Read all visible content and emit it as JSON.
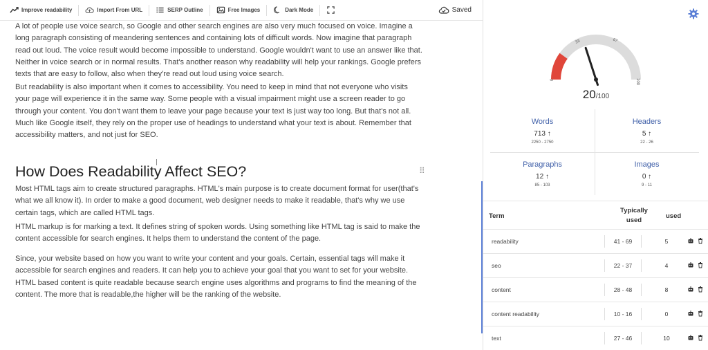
{
  "toolbar": {
    "improve_label": "Improve readability",
    "import_label": "Import From URL",
    "serp_label": "SERP Outline",
    "images_label": "Free Images",
    "dark_label": "Dark Mode",
    "saved_label": "Saved"
  },
  "editor": {
    "para1": "A lot of people use voice search, so Google and other search engines are also very much focused on voice. Imagine a long paragraph consisting of meandering sentences and containing lots of difficult words. Now imagine that paragraph read out loud. The voice result would become impossible to understand. Google wouldn't want to use an answer like that. Neither in voice search or in normal results. That's another reason why readability will help your rankings. Google prefers texts that are easy to follow, also when they're read out loud using voice search.",
    "para2": "But readability is also important when it comes to accessibility. You need to keep in mind that not everyone who visits your page will experience it in the same way. Some people with a visual impairment might use a screen reader to go through your content. You don't want them to leave your page because your text is just way too long. But that's not all. Much like Google itself, they rely on the proper use of headings to understand what your text is about. Remember that accessibility matters, and not just for SEO.",
    "heading": "How Does Readability Affect SEO?",
    "para3": "Most HTML tags aim to create structured paragraphs. HTML's main purpose is to create document format for user(that's what we all know it). In order to make a good document, web designer needs to make it readable, that's why we use certain tags, which are called HTML tags.",
    "para4": "HTML markup is for marking a text. It defines string of spoken words. Using something like HTML tag is said to make the content accessible for search engines. It helps them to understand the content of the page.",
    "para5": "Since, your website based on how you want to write your content and your goals. Certain, essential tags will make it accessible for search engines and readers. It can help you to achieve your goal that you want to set for your website.",
    "para6": "HTML based content is quite readable because search engine uses algorithms and programs to find the meaning of the content. The more that is readable,the higher will be the ranking of the website."
  },
  "gauge": {
    "score": 20,
    "max_label": "/100",
    "tick_0": "0",
    "tick_33": "33",
    "tick_67": "67",
    "tick_100": "100",
    "active_color": "#e0463a",
    "track_color": "#dcdcdc"
  },
  "stats": {
    "words": {
      "label": "Words",
      "value": "713 ↑",
      "range": "2250 - 2750"
    },
    "headers": {
      "label": "Headers",
      "value": "5 ↑",
      "range": "22 - 26"
    },
    "paragraphs": {
      "label": "Paragraphs",
      "value": "12 ↑",
      "range": "85 - 103"
    },
    "images": {
      "label": "Images",
      "value": "0 ↑",
      "range": "9 - 11"
    }
  },
  "terms": {
    "col_term": "Term",
    "col_typical_1": "Typically",
    "col_typical_2": "used",
    "col_used": "used",
    "rows": [
      {
        "term": "readability",
        "typical": "41 - 69",
        "used": "5"
      },
      {
        "term": "seo",
        "typical": "22 - 37",
        "used": "4"
      },
      {
        "term": "content",
        "typical": "28 - 48",
        "used": "8"
      },
      {
        "term": "content readability",
        "typical": "10 - 16",
        "used": "0"
      },
      {
        "term": "text",
        "typical": "27 - 46",
        "used": "10"
      }
    ]
  },
  "icons": [
    "trend-icon",
    "cloud-upload-icon",
    "list-icon",
    "image-icon",
    "moon-icon",
    "fullscreen-icon",
    "cloud-check-icon",
    "gear-icon",
    "robot-icon",
    "trash-icon",
    "drag-handle-icon"
  ]
}
